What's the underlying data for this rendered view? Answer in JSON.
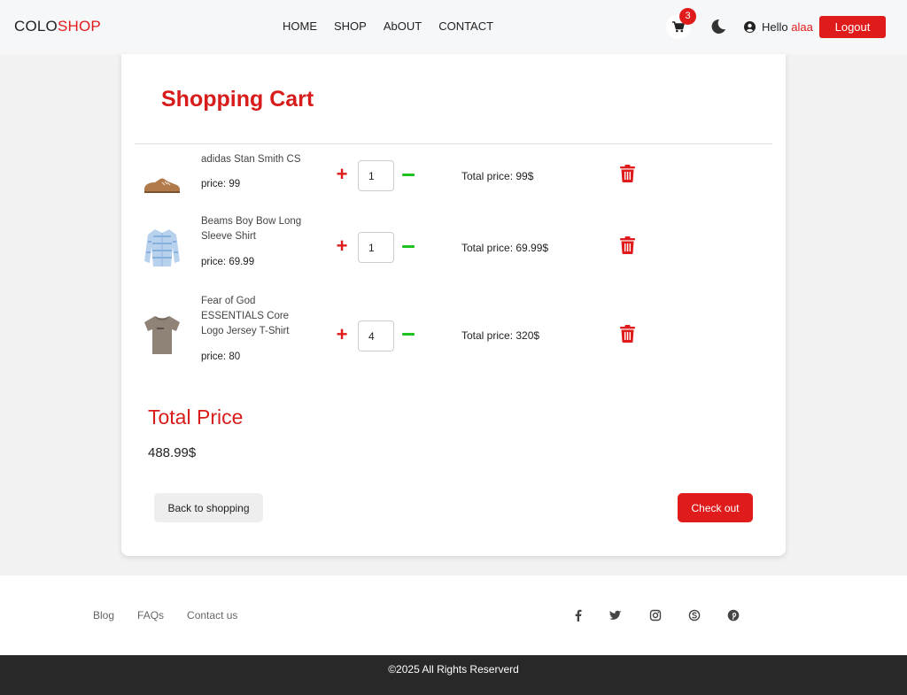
{
  "header": {
    "logo_part1": "COLO",
    "logo_part2": "SHOP",
    "nav": [
      "HOME",
      "SHOP",
      "AbOUT",
      "CONTACT"
    ],
    "cart_count": "3",
    "hello_label": "Hello ",
    "user_name": "alaa",
    "logout_label": "Logout",
    "icons": [
      "cart-icon",
      "moon-icon",
      "user-circle-icon"
    ]
  },
  "cart": {
    "title": "Shopping Cart",
    "items": [
      {
        "name": "adidas Stan Smith CS",
        "price_label": "price: 99",
        "quantity": "1",
        "total_label": "Total price: 99$",
        "image": "brown-sneaker"
      },
      {
        "name": "Beams Boy Bow Long Sleeve Shirt",
        "price_label": "price: 69.99",
        "quantity": "1",
        "total_label": "Total price: 69.99$",
        "image": "blue-striped-shirt"
      },
      {
        "name": "Fear of God ESSENTIALS Core Logo Jersey T-Shirt",
        "price_label": "price: 80",
        "quantity": "4",
        "total_label": "Total price: 320$",
        "image": "taupe-tshirt"
      }
    ],
    "total_title": "Total Price",
    "total_value": "488.99$",
    "back_label": "Back to shopping",
    "checkout_label": "Check out"
  },
  "footer": {
    "links": [
      "Blog",
      "FAQs",
      "Contact us"
    ],
    "social_icons": [
      "facebook-icon",
      "twitter-icon",
      "instagram-icon",
      "skype-icon",
      "pinterest-icon"
    ],
    "copyright": "©2025 All Rights Reserverd"
  },
  "colors": {
    "accent": "#e01b1b",
    "minus": "#1fc21f",
    "footer_bar": "#282828"
  }
}
